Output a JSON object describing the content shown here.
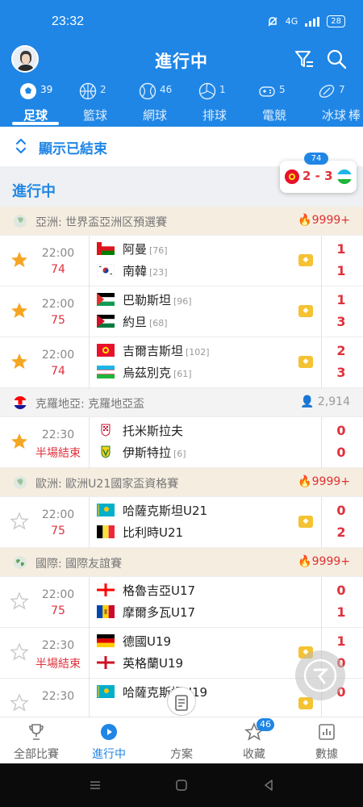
{
  "status_bar": {
    "time": "23:32",
    "signal": "4G",
    "battery": "28"
  },
  "header": {
    "title": "進行中"
  },
  "sport_tabs": [
    {
      "label": "足球",
      "count": "39",
      "active": true,
      "icon": "soccer-icon"
    },
    {
      "label": "籃球",
      "count": "2",
      "icon": "basketball-icon"
    },
    {
      "label": "網球",
      "count": "46",
      "icon": "tennis-icon"
    },
    {
      "label": "排球",
      "count": "1",
      "icon": "volleyball-icon"
    },
    {
      "label": "電競",
      "count": "5",
      "icon": "gamepad-icon"
    },
    {
      "label": "冰球",
      "count": "7",
      "icon": "hockey-icon"
    },
    {
      "label": "棒",
      "count": "",
      "icon": "baseball-icon"
    }
  ],
  "show_ended": {
    "label": "顯示已結束"
  },
  "section": {
    "title": "進行中"
  },
  "floating_score": {
    "minute": "74",
    "score": "2 - 3"
  },
  "leagues": [
    {
      "name": "亞洲: 世界盃亞洲区預選賽",
      "heat": "9999+",
      "icon": "asia-icon",
      "matches": [
        {
          "time": "22:00",
          "minute": "74",
          "starred": true,
          "home": {
            "name": "阿曼",
            "rank": "[76]",
            "flag": "oman"
          },
          "away": {
            "name": "南韓",
            "rank": "[23]",
            "flag": "korea"
          },
          "home_score": "1",
          "away_score": "1"
        },
        {
          "time": "22:00",
          "minute": "75",
          "starred": true,
          "home": {
            "name": "巴勒斯坦",
            "rank": "[96]",
            "flag": "palestine"
          },
          "away": {
            "name": "約旦",
            "rank": "[68]",
            "flag": "jordan"
          },
          "home_score": "1",
          "away_score": "3"
        },
        {
          "time": "22:00",
          "minute": "74",
          "starred": true,
          "home": {
            "name": "吉爾吉斯坦",
            "rank": "[102]",
            "flag": "kyrgyzstan"
          },
          "away": {
            "name": "烏茲別克",
            "rank": "[61]",
            "flag": "uzbekistan"
          },
          "home_score": "2",
          "away_score": "3"
        }
      ]
    },
    {
      "name": "克羅地亞: 克羅地亞盃",
      "viewers": "2,914",
      "icon": "croatia-icon",
      "matches": [
        {
          "time": "22:30",
          "minute": "半場結束",
          "starred": true,
          "home": {
            "name": "托米斯拉夫",
            "rank": "",
            "flag": "club1"
          },
          "away": {
            "name": "伊斯特拉",
            "rank": "[6]",
            "flag": "club2"
          },
          "home_score": "0",
          "away_score": "0"
        }
      ]
    },
    {
      "name": "歐洲: 歐洲U21國家盃資格賽",
      "heat": "9999+",
      "icon": "europe-icon",
      "matches": [
        {
          "time": "22:00",
          "minute": "75",
          "starred": false,
          "home": {
            "name": "哈薩克斯坦U21",
            "rank": "",
            "flag": "kazakhstan"
          },
          "away": {
            "name": "比利時U21",
            "rank": "",
            "flag": "belgium"
          },
          "home_score": "0",
          "away_score": "2"
        }
      ]
    },
    {
      "name": "國際: 國際友誼賽",
      "heat": "9999+",
      "icon": "world-icon",
      "matches": [
        {
          "time": "22:00",
          "minute": "75",
          "starred": false,
          "home": {
            "name": "格魯吉亞U17",
            "rank": "",
            "flag": "georgia"
          },
          "away": {
            "name": "摩爾多瓦U17",
            "rank": "",
            "flag": "moldova"
          },
          "home_score": "0",
          "away_score": "1"
        },
        {
          "time": "22:30",
          "minute": "半場結束",
          "starred": false,
          "home": {
            "name": "德國U19",
            "rank": "",
            "flag": "germany"
          },
          "away": {
            "name": "英格蘭U19",
            "rank": "",
            "flag": "england"
          },
          "home_score": "1",
          "away_score": "0"
        },
        {
          "time": "22:30",
          "minute": "",
          "starred": false,
          "home": {
            "name": "哈薩克斯坦U19",
            "rank": "",
            "flag": "kazakhstan"
          },
          "away": {
            "name": "",
            "rank": "",
            "flag": ""
          },
          "home_score": "0",
          "away_score": ""
        }
      ]
    }
  ],
  "bottom_nav": [
    {
      "label": "全部比賽",
      "icon": "trophy-icon"
    },
    {
      "label": "進行中",
      "icon": "play-icon",
      "active": true
    },
    {
      "label": "方案",
      "icon": "document-icon"
    },
    {
      "label": "收藏",
      "icon": "star-icon",
      "badge": "46"
    },
    {
      "label": "數據",
      "icon": "chart-icon"
    }
  ],
  "colors": {
    "primary": "#1f86e6",
    "score": "#e0313c",
    "star": "#f5a623"
  }
}
